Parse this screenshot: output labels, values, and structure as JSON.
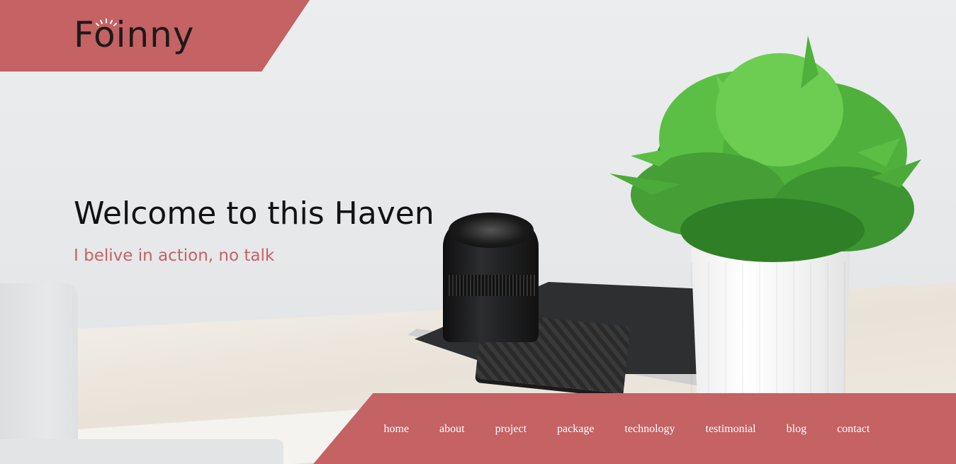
{
  "header": {
    "logo_text": "Foinny"
  },
  "hero": {
    "title": "Welcome to this Haven",
    "subtitle": "I belive in action, no talk"
  },
  "nav": {
    "items": [
      {
        "label": "home"
      },
      {
        "label": "about"
      },
      {
        "label": "project"
      },
      {
        "label": "package"
      },
      {
        "label": "technology"
      },
      {
        "label": "testimonial"
      },
      {
        "label": "blog"
      },
      {
        "label": "contact"
      }
    ]
  },
  "colors": {
    "accent": "#c46264",
    "text_dark": "#121212",
    "nav_text": "#ffffff"
  }
}
